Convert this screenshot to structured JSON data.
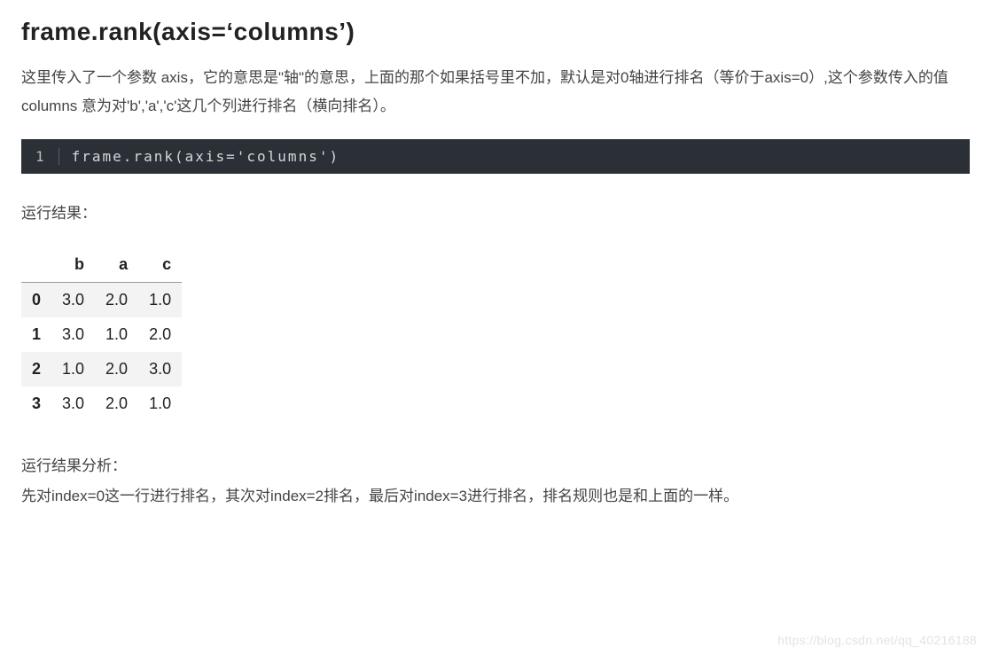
{
  "title": "frame.rank(axis=‘columns’)",
  "description": "这里传入了一个参数 axis，它的意思是\"轴\"的意思，上面的那个如果括号里不加，默认是对0轴进行排名（等价于axis=0）,这个参数传入的值 columns 意为对'b','a','c'这几个列进行排名（横向排名）。",
  "code": {
    "lineno": "1",
    "text": "frame.rank(axis='columns')"
  },
  "result_label": "运行结果：",
  "table": {
    "columns": [
      "b",
      "a",
      "c"
    ],
    "rows": [
      {
        "idx": "0",
        "vals": [
          "3.0",
          "2.0",
          "1.0"
        ]
      },
      {
        "idx": "1",
        "vals": [
          "3.0",
          "1.0",
          "2.0"
        ]
      },
      {
        "idx": "2",
        "vals": [
          "1.0",
          "2.0",
          "3.0"
        ]
      },
      {
        "idx": "3",
        "vals": [
          "3.0",
          "2.0",
          "1.0"
        ]
      }
    ]
  },
  "analysis_label": "运行结果分析：",
  "analysis": "先对index=0这一行进行排名，其次对index=2排名，最后对index=3进行排名，排名规则也是和上面的一样。",
  "watermark": "https://blog.csdn.net/qq_40216188"
}
